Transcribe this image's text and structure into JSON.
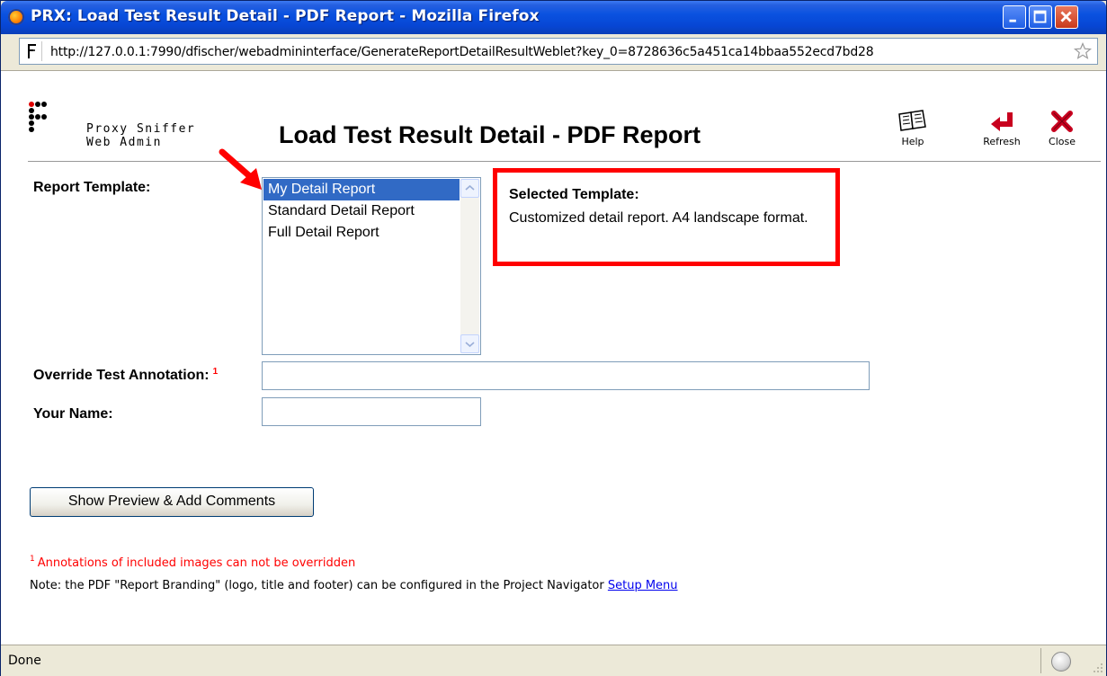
{
  "window": {
    "title": "PRX: Load Test Result Detail - PDF Report - Mozilla Firefox"
  },
  "browser": {
    "url": "http://127.0.0.1:7990/dfischer/webadmininterface/GenerateReportDetailResultWeblet?key_0=8728636c5a451ca14bbaa552ecd7bd28",
    "site_icon": "page-icon",
    "bookmark_icon": "star-icon"
  },
  "header": {
    "app_name_line1": "Proxy Sniffer",
    "app_name_line2": "Web Admin",
    "title": "Load Test Result Detail - PDF Report",
    "tools": [
      {
        "label": "Help",
        "icon": "book-icon"
      },
      {
        "label": "Refresh",
        "icon": "refresh-arrow-icon"
      },
      {
        "label": "Close",
        "icon": "x-close-icon"
      }
    ]
  },
  "form": {
    "report_template_label": "Report Template:",
    "templates": [
      "My Detail Report",
      "Standard Detail Report",
      "Full Detail Report"
    ],
    "selected_template": "My Detail Report",
    "selected_template_title": "Selected Template:",
    "selected_template_description": "Customized detail report. A4 landscape format.",
    "annotation_label": "Override Test Annotation:",
    "annotation_marker": "1",
    "annotation_value": "",
    "name_label": "Your Name:",
    "name_value": "",
    "preview_button": "Show Preview & Add Comments"
  },
  "notes": {
    "footnote_marker": "1",
    "footnote": "Annotations of included images can not be overridden",
    "branding_note": "Note: the PDF \"Report Branding\" (logo, title and footer) can be configured in the Project Navigator",
    "setup_link": "Setup Menu"
  },
  "statusbar": {
    "text": "Done"
  },
  "colors": {
    "titlebar": "#0a52e0",
    "selection": "#316ac5",
    "highlight_box": "#ff0000",
    "required_marker": "#ff0000",
    "link": "#0000ee"
  }
}
